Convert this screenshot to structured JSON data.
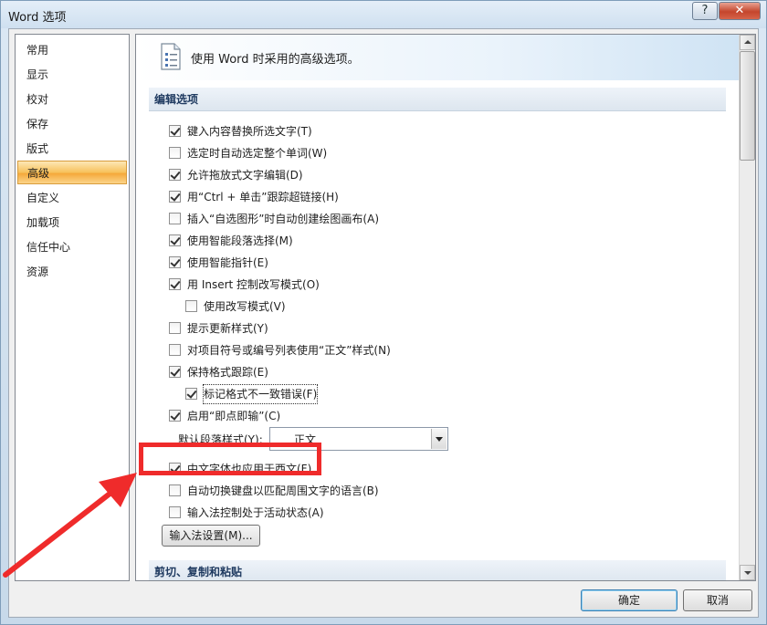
{
  "window": {
    "title": "Word 选项",
    "help_label": "?",
    "close_label": "✕"
  },
  "nav": {
    "items": [
      "常用",
      "显示",
      "校对",
      "保存",
      "版式",
      "高级",
      "自定义",
      "加载项",
      "信任中心",
      "资源"
    ],
    "active": "高级"
  },
  "header": {
    "text": "使用 Word 时采用的高级选项。",
    "icon": "settings-document-icon"
  },
  "sections": {
    "edit": "编辑选项",
    "clipboard": "剪切、复制和粘贴"
  },
  "options": [
    {
      "label": "键入内容替换所选文字(T)",
      "checked": true
    },
    {
      "label": "选定时自动选定整个单词(W)",
      "checked": false
    },
    {
      "label": "允许拖放式文字编辑(D)",
      "checked": true
    },
    {
      "label": "用“Ctrl + 单击”跟踪超链接(H)",
      "checked": true
    },
    {
      "label": "插入“自选图形”时自动创建绘图画布(A)",
      "checked": false
    },
    {
      "label": "使用智能段落选择(M)",
      "checked": true
    },
    {
      "label": "使用智能指针(E)",
      "checked": true
    },
    {
      "label": "用 Insert 控制改写模式(O)",
      "checked": true
    },
    {
      "label": "使用改写模式(V)",
      "checked": false
    },
    {
      "label": "提示更新样式(Y)",
      "checked": false
    },
    {
      "label": "对项目符号或编号列表使用“正文”样式(N)",
      "checked": false
    },
    {
      "label": "保持格式跟踪(E)",
      "checked": true
    },
    {
      "label": "标记格式不一致错误(F)",
      "checked": true
    },
    {
      "label": "启用“即点即输”(C)",
      "checked": true
    },
    {
      "label": "中文字体也应用于西文(F)",
      "checked": true
    },
    {
      "label": "自动切换键盘以匹配周围文字的语言(B)",
      "checked": false
    },
    {
      "label": "输入法控制处于活动状态(A)",
      "checked": false
    }
  ],
  "default_para": {
    "label": "默认段落样式(Y):",
    "value": "正文"
  },
  "buttons": {
    "ime_settings": "输入法设置(M)...",
    "ok": "确定",
    "cancel": "取消"
  },
  "colors": {
    "annotation": "#ef2b2b",
    "nav_active": "#f7c15b",
    "section_text": "#1f3a60"
  }
}
